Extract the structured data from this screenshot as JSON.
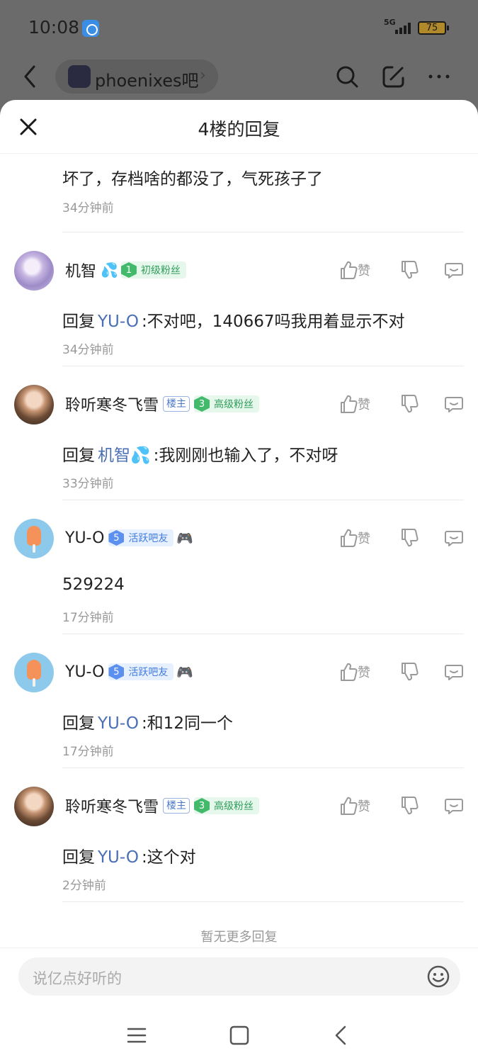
{
  "status_bar": {
    "time": "10:08",
    "network": "5G",
    "battery": "75"
  },
  "background_nav": {
    "forum_name": "phoenixes吧"
  },
  "sheet": {
    "title": "4楼的回复"
  },
  "partial_reply": {
    "content": "坏了，存档啥的都没了，气死孩子了",
    "time": "34分钟前"
  },
  "labels": {
    "like": "赞",
    "reply_prefix": "回复"
  },
  "replies": [
    {
      "username": "机智",
      "emoji": "💦",
      "host_badge": "",
      "level": "1",
      "level_title": "初级粉丝",
      "level_color": "#43b96b",
      "reply_to": "YU-O",
      "reply_to_emoji": "",
      "content": ":不对吧，140667吗我用着显示不对",
      "time": "34分钟前"
    },
    {
      "username": "聆听寒冬飞雪",
      "emoji": "",
      "host_badge": "楼主",
      "level": "3",
      "level_title": "高级粉丝",
      "level_color": "#43b96b",
      "reply_to": "机智",
      "reply_to_emoji": "💦",
      "content": ":我刚刚也输入了，不对呀",
      "time": "33分钟前"
    },
    {
      "username": "YU-O",
      "emoji": "",
      "host_badge": "",
      "level": "5",
      "level_title": "活跃吧友",
      "level_color": "#5b8ff0",
      "extra_icon": "🎮",
      "content": "529224",
      "time": "17分钟前"
    },
    {
      "username": "YU-O",
      "emoji": "",
      "host_badge": "",
      "level": "5",
      "level_title": "活跃吧友",
      "level_color": "#5b8ff0",
      "extra_icon": "🎮",
      "reply_to": "YU-O",
      "reply_to_emoji": "",
      "content": ":和12同一个",
      "time": "17分钟前"
    },
    {
      "username": "聆听寒冬飞雪",
      "emoji": "",
      "host_badge": "楼主",
      "level": "3",
      "level_title": "高级粉丝",
      "level_color": "#43b96b",
      "reply_to": "YU-O",
      "reply_to_emoji": "",
      "content": ":这个对",
      "time": "2分钟前"
    }
  ],
  "footer": {
    "no_more": "暂无更多回复"
  },
  "composer": {
    "placeholder": "说亿点好听的"
  },
  "icons": {
    "close": "close-icon",
    "like": "thumbs-up-icon",
    "dislike": "thumbs-down-icon",
    "comment": "comment-icon",
    "emoji": "smiley-icon",
    "search": "search-icon",
    "edit": "edit-icon",
    "more": "more-icon",
    "back": "chevron-left-icon"
  }
}
